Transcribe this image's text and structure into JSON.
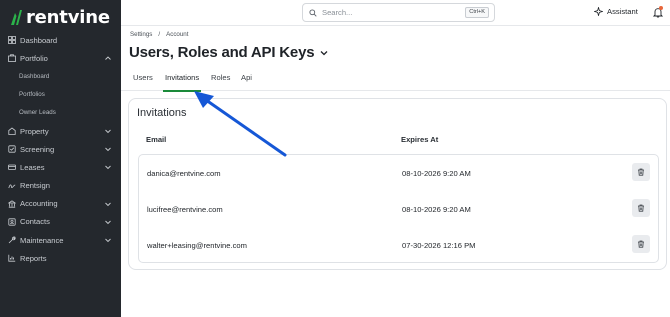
{
  "brand": {
    "name": "rentvine",
    "accent": "#1a8a3a"
  },
  "sidebar": {
    "items": [
      {
        "label": "Dashboard",
        "icon": "dashboard-icon",
        "chevron": false
      },
      {
        "label": "Portfolio",
        "icon": "portfolio-icon",
        "chevron": "up"
      },
      {
        "label": "Property",
        "icon": "property-icon",
        "chevron": "down"
      },
      {
        "label": "Screening",
        "icon": "screening-icon",
        "chevron": "down"
      },
      {
        "label": "Leases",
        "icon": "leases-icon",
        "chevron": "down"
      },
      {
        "label": "Rentsign",
        "icon": "rentsign-icon",
        "chevron": false
      },
      {
        "label": "Accounting",
        "icon": "accounting-icon",
        "chevron": "down"
      },
      {
        "label": "Contacts",
        "icon": "contacts-icon",
        "chevron": "down"
      },
      {
        "label": "Maintenance",
        "icon": "maintenance-icon",
        "chevron": "down"
      },
      {
        "label": "Reports",
        "icon": "reports-icon",
        "chevron": false
      }
    ],
    "portfolio_sub": [
      "Dashboard",
      "Portfolios",
      "Owner Leads"
    ]
  },
  "topbar": {
    "search_placeholder": "Search...",
    "shortcut": "Ctrl+K",
    "assistant_label": "Assistant"
  },
  "breadcrumb": {
    "first": "Settings",
    "separator": "/",
    "second": "Account"
  },
  "page": {
    "title": "Users, Roles and API Keys"
  },
  "tabs": [
    {
      "label": "Users",
      "active": false
    },
    {
      "label": "Invitations",
      "active": true
    },
    {
      "label": "Roles",
      "active": false
    },
    {
      "label": "Api",
      "active": false
    }
  ],
  "invitations": {
    "title": "Invitations",
    "columns": {
      "email": "Email",
      "expires": "Expires At"
    },
    "rows": [
      {
        "email": "danica@rentvine.com",
        "expires": "08-10-2026 9:20 AM"
      },
      {
        "email": "lucifree@rentvine.com",
        "expires": "08-10-2026 9:20 AM"
      },
      {
        "email": "walter+leasing@rentvine.com",
        "expires": "07-30-2026 12:16 PM"
      }
    ]
  },
  "annotation": {
    "arrow_color": "#1557d6"
  }
}
